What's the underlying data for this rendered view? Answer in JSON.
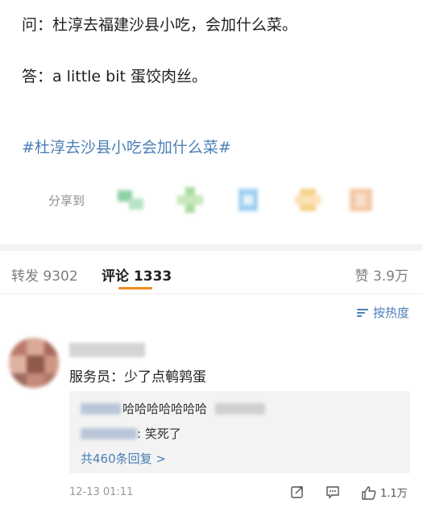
{
  "post": {
    "question": "问：杜淳去福建沙县小吃，会加什么菜。",
    "answer": "答：a little bit 蛋饺肉丝。",
    "hashtag": "#杜淳去沙县小吃会加什么菜#",
    "share_label": "分享到",
    "share_icons": [
      "wechat-icon",
      "moments-icon",
      "qq-icon",
      "qzone-icon",
      "more-share-icon"
    ]
  },
  "tabs": {
    "repost": "转发 9302",
    "comment": "评论 1333",
    "like": "赞 3.9万"
  },
  "sort": {
    "label": "按热度"
  },
  "comment": {
    "text": "服务员：少了点鹌鹑蛋",
    "replies": [
      {
        "text": "哈哈哈哈哈哈哈"
      },
      {
        "text": ": 笑死了"
      }
    ],
    "more_replies": "共460条回复 >",
    "timestamp": "12-13 01:11",
    "like_count": "1.1万"
  },
  "colors": {
    "link": "#4a7fb6",
    "accent": "#f08a24",
    "muted": "#9a9a9a"
  }
}
